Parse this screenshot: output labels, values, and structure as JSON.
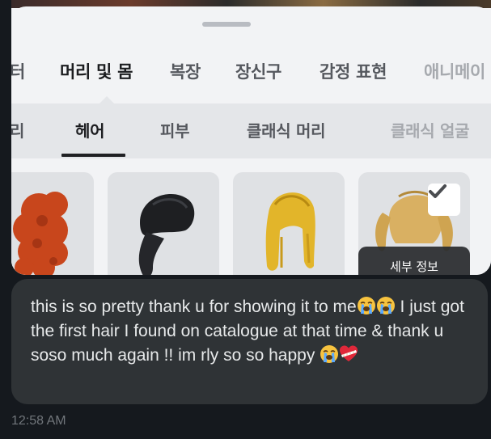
{
  "catalog": {
    "category_tabs": [
      {
        "label": "터",
        "active": false
      },
      {
        "label": "머리 및 몸",
        "active": true
      },
      {
        "label": "복장",
        "active": false
      },
      {
        "label": "장신구",
        "active": false
      },
      {
        "label": "감정 표현",
        "active": false
      },
      {
        "label": "애니메이",
        "active": false
      }
    ],
    "sub_tabs": [
      {
        "label": "리",
        "active": false
      },
      {
        "label": "헤어",
        "active": true
      },
      {
        "label": "피부",
        "active": false
      },
      {
        "label": "클래식 머리",
        "active": false
      },
      {
        "label": "클래식 얼굴",
        "active": false
      }
    ],
    "items": [
      {
        "name": "red-curly-hair",
        "color": "#c8461c",
        "selected": false
      },
      {
        "name": "black-ponytail-hair",
        "color": "#1e1f22",
        "selected": false
      },
      {
        "name": "golden-long-hair",
        "color": "#e2b52a",
        "selected": false
      },
      {
        "name": "blonde-pigtail-hair",
        "color": "#d9b062",
        "selected": true
      }
    ],
    "details_label": "세부 정보"
  },
  "message": {
    "text_line1": "this is so pretty thank u for showing it to me",
    "text_line2": "I just got the first hair I found on catalogue at that time & thank u soso much again !! im rly so so happy",
    "emojis": [
      "loudly-crying-face",
      "loudly-crying-face",
      "loudly-crying-face",
      "mending-heart"
    ],
    "timestamp": "12:58 AM"
  },
  "colors": {
    "background": "#15191e",
    "bubble": "#2f3336",
    "message_text": "#e7e9ea",
    "timestamp": "#71767b",
    "card": "#f2f3f5"
  }
}
